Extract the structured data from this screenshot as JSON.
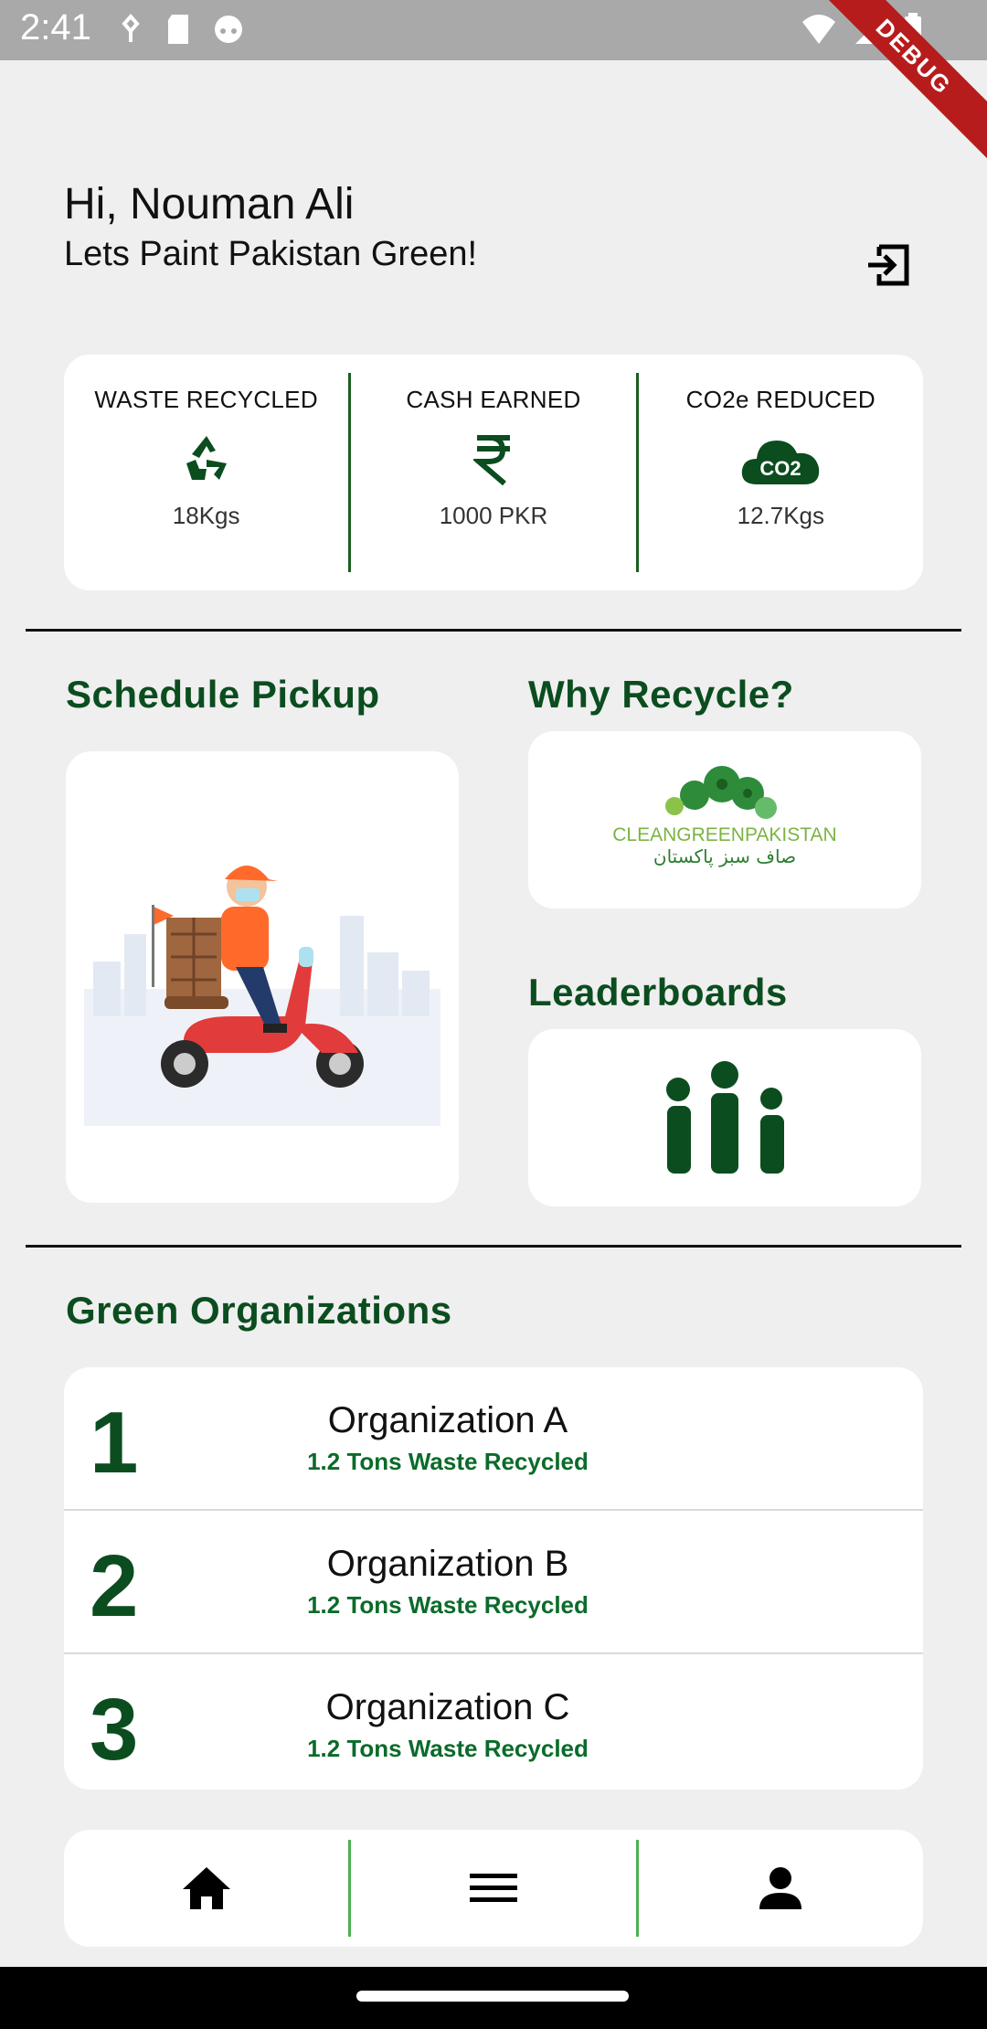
{
  "status_bar": {
    "time": "2:41",
    "debug_label": "DEBUG"
  },
  "header": {
    "greeting": "Hi, Nouman Ali",
    "tagline": "Lets Paint Pakistan Green!"
  },
  "stats": [
    {
      "label": "WASTE RECYCLED",
      "icon": "recycle-icon",
      "value": "18Kgs"
    },
    {
      "label": "CASH EARNED",
      "icon": "rupee-icon",
      "value": "1000 PKR"
    },
    {
      "label": "CO2e REDUCED",
      "icon": "co2-cloud-icon",
      "value": "12.7Kgs"
    }
  ],
  "sections": {
    "schedule_pickup": "Schedule Pickup",
    "why_recycle": "Why Recycle?",
    "leaderboards": "Leaderboards",
    "green_orgs": "Green Organizations"
  },
  "logo": {
    "text_en": "CLEANGREENPAKISTAN",
    "text_ur": "صاف سبز پاکستان"
  },
  "organizations": [
    {
      "rank": "1",
      "name": "Organization A",
      "detail": "1.2 Tons Waste Recycled"
    },
    {
      "rank": "2",
      "name": "Organization B",
      "detail": "1.2 Tons Waste Recycled"
    },
    {
      "rank": "3",
      "name": "Organization C",
      "detail": "1.2 Tons Waste Recycled"
    }
  ],
  "colors": {
    "primary_green": "#0b4d1f",
    "accent_green": "#4caf50",
    "status_bar": "#a9a9a9"
  }
}
